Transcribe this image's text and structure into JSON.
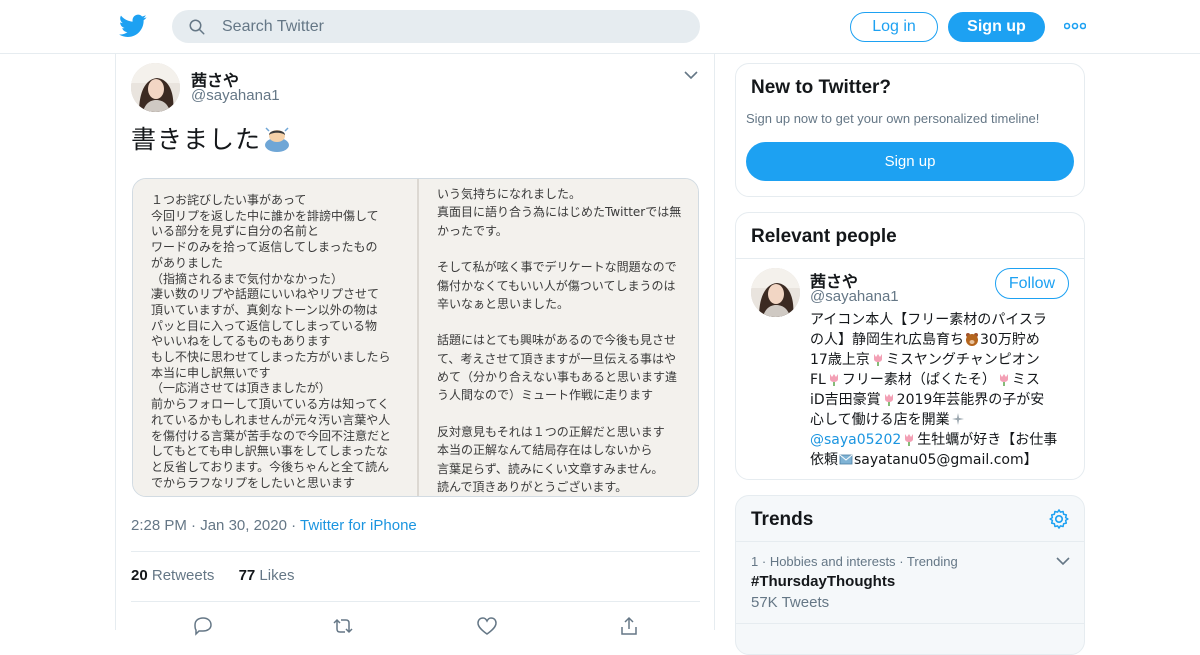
{
  "header": {
    "search_placeholder": "Search Twitter",
    "login_label": "Log in",
    "signup_label": "Sign up",
    "brand_color": "#1da1f2"
  },
  "tweet": {
    "author_name": "茜さや",
    "author_handle": "@sayahana1",
    "text": "書きました",
    "time": "2:28 PM",
    "date": "Jan 30, 2020",
    "source": "Twitter for iPhone",
    "retweets_count": "20",
    "retweets_label": "Retweets",
    "likes_count": "77",
    "likes_label": "Likes",
    "media": {
      "left_lines": [
        "１つお詫びしたい事があって",
        "今回リプを返した中に誰かを誹謗中傷して",
        "いる部分を見ずに自分の名前と",
        "ワードのみを拾って返信してしまったもの",
        "がありました",
        "（指摘されるまで気付かなかった）",
        "凄い数のリプや話題にいいねやリプさせて",
        "頂いていますが、真剣なトーン以外の物は",
        "パッと目に入って返信してしまっている物",
        "やいいねをしてるものもあります",
        "もし不快に思わせてしまった方がいましたら",
        "本当に申し訳無いです",
        "（一応消させては頂きましたが）",
        "前からフォローして頂いている方は知ってく",
        "れているかもしれませんが元々汚い言葉や人",
        "を傷付ける言葉が苦手なので今回不注意だと",
        "してもとても申し訳無い事をしてしまったな",
        "と反省しております。今後ちゃんと全て読ん",
        "でからラフなリプをしたいと思います"
      ],
      "right_lines": [
        "いう気持ちになれました。",
        "真面目に語り合う為にはじめたTwitterでは無",
        "かったです。",
        "",
        "そして私が呟く事でデリケートな問題なので",
        "傷付かなくてもいい人が傷ついてしまうのは",
        "辛いなぁと思いました。",
        "",
        "話題にはとても興味があるので今後も見させ",
        "て、考えさせて頂きますが一旦伝える事はや",
        "めて（分かり合えない事もあると思います違",
        "う人間なので）ミュート作戦に走ります",
        "",
        "反対意見もそれは１つの正解だと思います",
        "本当の正解なんて結局存在はしないから",
        "言葉足らず、読みにくい文章すみません。",
        "読んで頂きありがとうございます。"
      ]
    }
  },
  "sidebar": {
    "new_to_twitter": {
      "title": "New to Twitter?",
      "subtitle": "Sign up now to get your own personalized timeline!",
      "signup_label": "Sign up"
    },
    "relevant_people": {
      "title": "Relevant people",
      "person": {
        "name": "茜さや",
        "handle": "@sayahana1",
        "follow_label": "Follow",
        "bio_lines": [
          "アイコン本人【フリー素材のパイスラ",
          "の人】静岡生れ広島育ち",
          "17歳上京",
          "FL",
          "iD吉田豪賞",
          "心して働ける店を開業",
          "@saya05202",
          "依頼"
        ],
        "bio_parts": {
          "l2_tail": "30万貯め",
          "l3_tail": "ミスヤングチャンピオン",
          "l4_mid": "フリー素材（ぱくたそ）",
          "l4_tail": "ミス",
          "l5_tail": "2019年芸能界の子が安",
          "l7_tail": "生牡蠣が好き【お仕事",
          "l8_tail": "sayatanu05@gmail.com】"
        }
      }
    },
    "trends": {
      "title": "Trends",
      "items": [
        {
          "rank": "1",
          "category": "Hobbies and interests",
          "status": "Trending",
          "name": "#ThursdayThoughts",
          "count": "57K Tweets"
        }
      ]
    }
  }
}
